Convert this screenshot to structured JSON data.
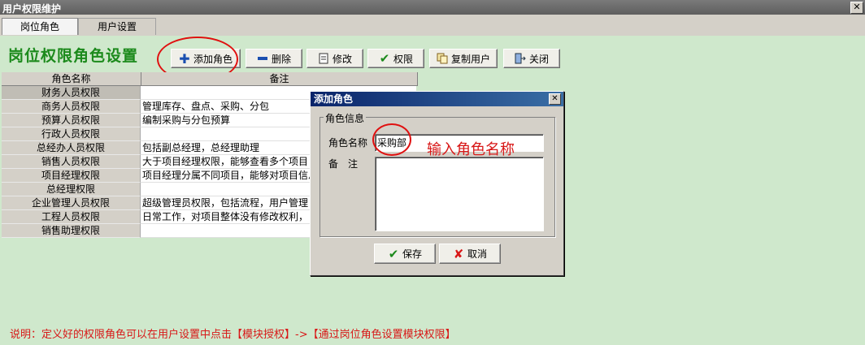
{
  "window": {
    "title": "用户权限维护",
    "close_glyph": "✕"
  },
  "tabs": [
    {
      "label": "岗位角色",
      "active": true
    },
    {
      "label": "用户设置",
      "active": false
    }
  ],
  "heading": "岗位权限角色设置",
  "toolbar": {
    "add": "添加角色",
    "delete": "删除",
    "edit": "修改",
    "permission": "权限",
    "copy_user": "复制用户",
    "close": "关闭"
  },
  "grid": {
    "columns": [
      "角色名称",
      "备注"
    ],
    "rows": [
      {
        "name": "财务人员权限",
        "note": ""
      },
      {
        "name": "商务人员权限",
        "note": "管理库存、盘点、采购、分包"
      },
      {
        "name": "预算人员权限",
        "note": "编制采购与分包预算"
      },
      {
        "name": "行政人员权限",
        "note": ""
      },
      {
        "name": "总经办人员权限",
        "note": "包括副总经理，总经理助理"
      },
      {
        "name": "销售人员权限",
        "note": "大于项目经理权限，能够查看多个项目"
      },
      {
        "name": "项目经理权限",
        "note": "项目经理分属不同项目，能够对项目信息"
      },
      {
        "name": "总经理权限",
        "note": ""
      },
      {
        "name": "企业管理人员权限",
        "note": "超级管理员权限，包括流程，用户管理"
      },
      {
        "name": "工程人员权限",
        "note": "日常工作，对项目整体没有修改权利，"
      },
      {
        "name": "销售助理权限",
        "note": ""
      }
    ]
  },
  "note": "说明：定义好的权限角色可以在用户设置中点击【模块授权】->【通过岗位角色设置模块权限】",
  "dialog": {
    "title": "添加角色",
    "close_glyph": "✕",
    "group_label": "角色信息",
    "name_label": "角色名称",
    "name_value": "采购部",
    "remark_label": "备　注",
    "remark_value": "",
    "save": "保存",
    "cancel": "取消"
  },
  "hint": "输入角色名称",
  "colors": {
    "accent_green": "#1c8a1c",
    "note_red": "#d81818",
    "bg_green": "#cfe8cc"
  }
}
